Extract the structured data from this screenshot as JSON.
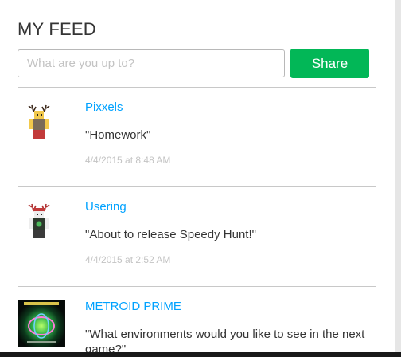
{
  "feed": {
    "title": "MY FEED",
    "status_placeholder": "What are you up to?",
    "share_label": "Share",
    "posts": [
      {
        "user": "Pixxels",
        "text": "\"Homework\"",
        "timestamp": "4/4/2015 at 8:48 AM",
        "avatar_icon": "avatar-antler-red-icon"
      },
      {
        "user": "Usering",
        "text": "\"About to release Speedy Hunt!\"",
        "timestamp": "4/4/2015 at 2:52 AM",
        "avatar_icon": "avatar-antler-white-icon"
      },
      {
        "user": "METROID PRIME",
        "text": "\"What environments would you like to see in the next game?\"",
        "timestamp": "",
        "avatar_icon": "game-thumbnail-icon"
      }
    ]
  },
  "colors": {
    "accent_link": "#00a2ff",
    "share_button": "#02b757",
    "text": "#343434",
    "muted": "#c4c4c4"
  }
}
